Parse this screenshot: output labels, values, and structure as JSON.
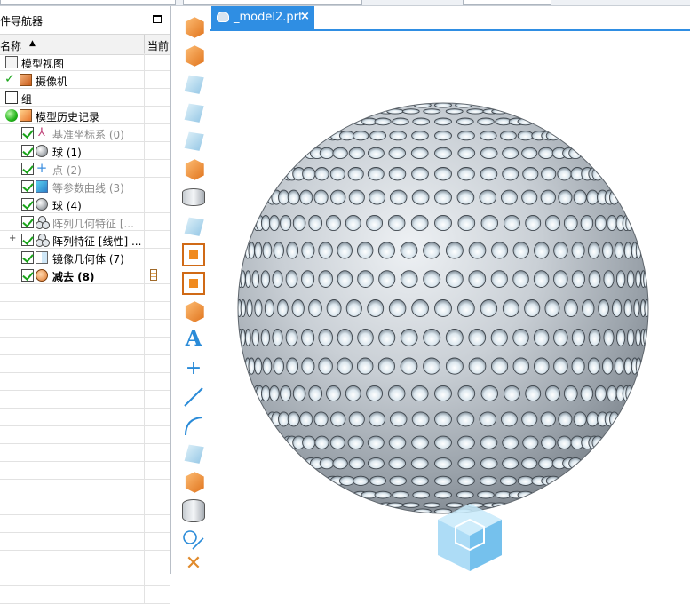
{
  "navigator": {
    "title": "件导航器",
    "column_name": "名称",
    "column_current": "当前",
    "items": [
      {
        "label": "模型视图"
      },
      {
        "label": "摄像机"
      },
      {
        "label": "组"
      },
      {
        "label": "模型历史记录"
      },
      {
        "label": "基准坐标系 (0)"
      },
      {
        "label": "球 (1)"
      },
      {
        "label": "点 (2)"
      },
      {
        "label": "等参数曲线 (3)"
      },
      {
        "label": "球 (4)"
      },
      {
        "label": "阵列几何特征 [..."
      },
      {
        "label": "阵列特征 [线性] ..."
      },
      {
        "label": "镜像几何体 (7)"
      },
      {
        "label": "减去 (8)"
      }
    ]
  },
  "tab": {
    "label": "_model2.prt",
    "close": "×"
  },
  "toolbar": {
    "text_tool": "A"
  },
  "colors": {
    "accent": "#2f8ee3",
    "check_green": "#19a319",
    "dim_text": "#8c8c8c"
  }
}
